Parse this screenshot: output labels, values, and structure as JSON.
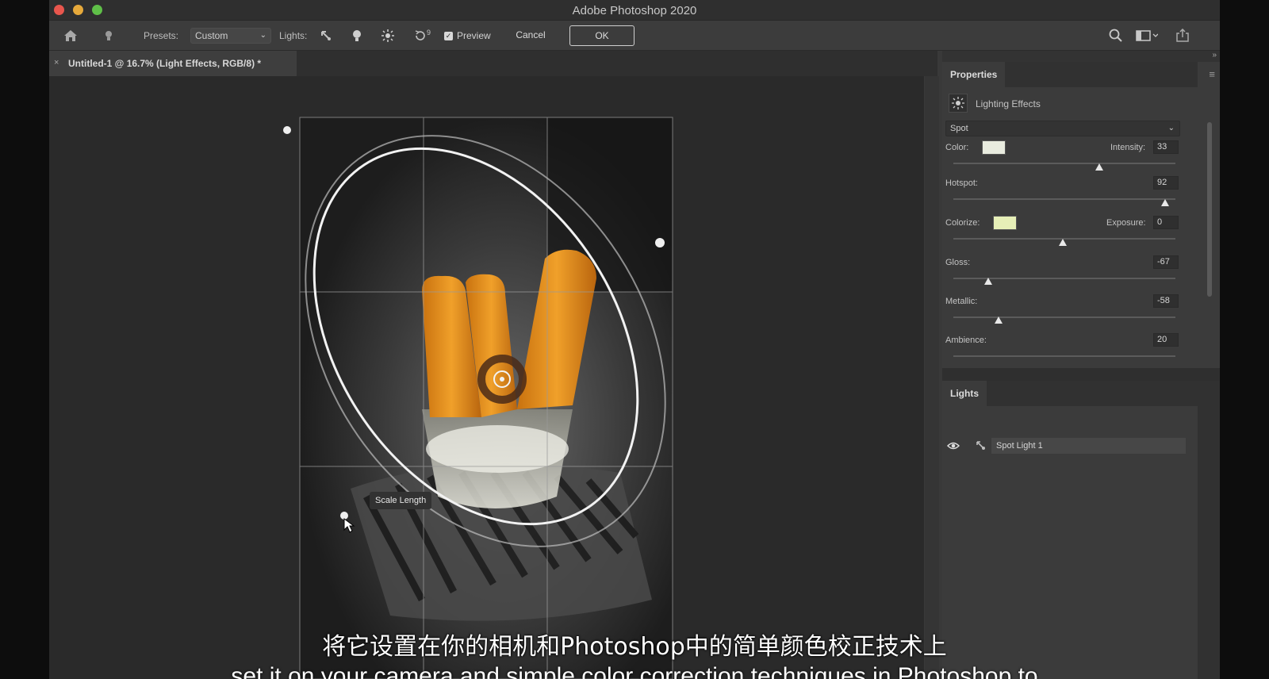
{
  "app": {
    "title": "Adobe Photoshop 2020"
  },
  "options_bar": {
    "presets_label": "Presets:",
    "presets_value": "Custom",
    "lights_label": "Lights:",
    "reset_superscript": "9",
    "preview_label": "Preview",
    "cancel_label": "Cancel",
    "ok_label": "OK",
    "icons": [
      "home-icon",
      "lightbulb-icon",
      "spot-light-icon",
      "point-light-icon",
      "infinite-light-icon",
      "reset-icon",
      "search-icon",
      "workspace-icon",
      "share-icon"
    ]
  },
  "document": {
    "tab_title": "Untitled-1 @ 16.7% (Light Effects, RGB/8) *",
    "close": "×"
  },
  "canvas": {
    "tooltip": "Scale Length"
  },
  "properties": {
    "tab_label": "Properties",
    "effect_name": "Lighting Effects",
    "light_type": "Spot",
    "color_label": "Color:",
    "color_hex": "#e9ecdf",
    "intensity_label": "Intensity:",
    "intensity": "33",
    "hotspot_label": "Hotspot:",
    "hotspot": "92",
    "colorize_label": "Colorize:",
    "colorize_hex": "#e6efb7",
    "exposure_label": "Exposure:",
    "exposure": "0",
    "gloss_label": "Gloss:",
    "gloss": "-67",
    "metallic_label": "Metallic:",
    "metallic": "-58",
    "ambience_label": "Ambience:",
    "ambience": "20"
  },
  "lights": {
    "tab_label": "Lights",
    "items": [
      "Spot Light 1"
    ]
  },
  "subtitles": {
    "cn": "将它设置在你的相机和Photoshop中的简单颜色校正技术上",
    "en": "set it on your camera and simple color correction techniques in Photoshop to"
  },
  "colors": {
    "ui_bg": "#393939",
    "canvas_bg": "#2a2a2a",
    "accent_red": "#e8564d"
  }
}
